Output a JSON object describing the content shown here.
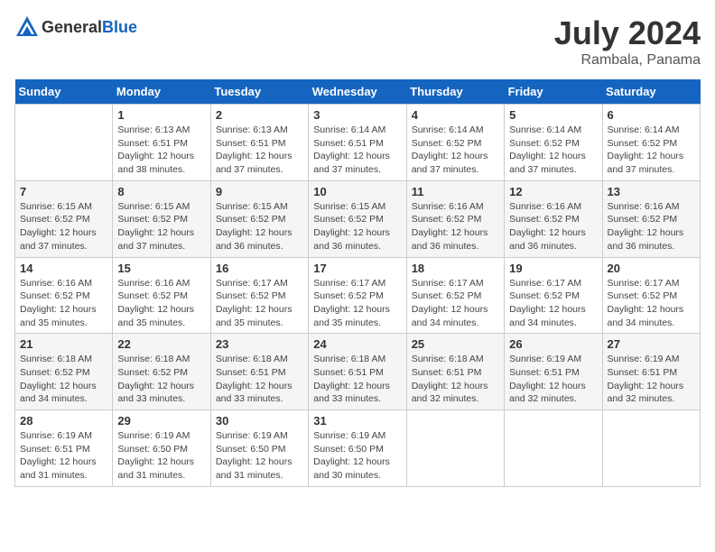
{
  "header": {
    "logo_general": "General",
    "logo_blue": "Blue",
    "month_title": "July 2024",
    "location": "Rambala, Panama"
  },
  "days_of_week": [
    "Sunday",
    "Monday",
    "Tuesday",
    "Wednesday",
    "Thursday",
    "Friday",
    "Saturday"
  ],
  "weeks": [
    [
      {
        "day": "",
        "info": ""
      },
      {
        "day": "1",
        "info": "Sunrise: 6:13 AM\nSunset: 6:51 PM\nDaylight: 12 hours\nand 38 minutes."
      },
      {
        "day": "2",
        "info": "Sunrise: 6:13 AM\nSunset: 6:51 PM\nDaylight: 12 hours\nand 37 minutes."
      },
      {
        "day": "3",
        "info": "Sunrise: 6:14 AM\nSunset: 6:51 PM\nDaylight: 12 hours\nand 37 minutes."
      },
      {
        "day": "4",
        "info": "Sunrise: 6:14 AM\nSunset: 6:52 PM\nDaylight: 12 hours\nand 37 minutes."
      },
      {
        "day": "5",
        "info": "Sunrise: 6:14 AM\nSunset: 6:52 PM\nDaylight: 12 hours\nand 37 minutes."
      },
      {
        "day": "6",
        "info": "Sunrise: 6:14 AM\nSunset: 6:52 PM\nDaylight: 12 hours\nand 37 minutes."
      }
    ],
    [
      {
        "day": "7",
        "info": "Sunrise: 6:15 AM\nSunset: 6:52 PM\nDaylight: 12 hours\nand 37 minutes."
      },
      {
        "day": "8",
        "info": "Sunrise: 6:15 AM\nSunset: 6:52 PM\nDaylight: 12 hours\nand 37 minutes."
      },
      {
        "day": "9",
        "info": "Sunrise: 6:15 AM\nSunset: 6:52 PM\nDaylight: 12 hours\nand 36 minutes."
      },
      {
        "day": "10",
        "info": "Sunrise: 6:15 AM\nSunset: 6:52 PM\nDaylight: 12 hours\nand 36 minutes."
      },
      {
        "day": "11",
        "info": "Sunrise: 6:16 AM\nSunset: 6:52 PM\nDaylight: 12 hours\nand 36 minutes."
      },
      {
        "day": "12",
        "info": "Sunrise: 6:16 AM\nSunset: 6:52 PM\nDaylight: 12 hours\nand 36 minutes."
      },
      {
        "day": "13",
        "info": "Sunrise: 6:16 AM\nSunset: 6:52 PM\nDaylight: 12 hours\nand 36 minutes."
      }
    ],
    [
      {
        "day": "14",
        "info": "Sunrise: 6:16 AM\nSunset: 6:52 PM\nDaylight: 12 hours\nand 35 minutes."
      },
      {
        "day": "15",
        "info": "Sunrise: 6:16 AM\nSunset: 6:52 PM\nDaylight: 12 hours\nand 35 minutes."
      },
      {
        "day": "16",
        "info": "Sunrise: 6:17 AM\nSunset: 6:52 PM\nDaylight: 12 hours\nand 35 minutes."
      },
      {
        "day": "17",
        "info": "Sunrise: 6:17 AM\nSunset: 6:52 PM\nDaylight: 12 hours\nand 35 minutes."
      },
      {
        "day": "18",
        "info": "Sunrise: 6:17 AM\nSunset: 6:52 PM\nDaylight: 12 hours\nand 34 minutes."
      },
      {
        "day": "19",
        "info": "Sunrise: 6:17 AM\nSunset: 6:52 PM\nDaylight: 12 hours\nand 34 minutes."
      },
      {
        "day": "20",
        "info": "Sunrise: 6:17 AM\nSunset: 6:52 PM\nDaylight: 12 hours\nand 34 minutes."
      }
    ],
    [
      {
        "day": "21",
        "info": "Sunrise: 6:18 AM\nSunset: 6:52 PM\nDaylight: 12 hours\nand 34 minutes."
      },
      {
        "day": "22",
        "info": "Sunrise: 6:18 AM\nSunset: 6:52 PM\nDaylight: 12 hours\nand 33 minutes."
      },
      {
        "day": "23",
        "info": "Sunrise: 6:18 AM\nSunset: 6:51 PM\nDaylight: 12 hours\nand 33 minutes."
      },
      {
        "day": "24",
        "info": "Sunrise: 6:18 AM\nSunset: 6:51 PM\nDaylight: 12 hours\nand 33 minutes."
      },
      {
        "day": "25",
        "info": "Sunrise: 6:18 AM\nSunset: 6:51 PM\nDaylight: 12 hours\nand 32 minutes."
      },
      {
        "day": "26",
        "info": "Sunrise: 6:19 AM\nSunset: 6:51 PM\nDaylight: 12 hours\nand 32 minutes."
      },
      {
        "day": "27",
        "info": "Sunrise: 6:19 AM\nSunset: 6:51 PM\nDaylight: 12 hours\nand 32 minutes."
      }
    ],
    [
      {
        "day": "28",
        "info": "Sunrise: 6:19 AM\nSunset: 6:51 PM\nDaylight: 12 hours\nand 31 minutes."
      },
      {
        "day": "29",
        "info": "Sunrise: 6:19 AM\nSunset: 6:50 PM\nDaylight: 12 hours\nand 31 minutes."
      },
      {
        "day": "30",
        "info": "Sunrise: 6:19 AM\nSunset: 6:50 PM\nDaylight: 12 hours\nand 31 minutes."
      },
      {
        "day": "31",
        "info": "Sunrise: 6:19 AM\nSunset: 6:50 PM\nDaylight: 12 hours\nand 30 minutes."
      },
      {
        "day": "",
        "info": ""
      },
      {
        "day": "",
        "info": ""
      },
      {
        "day": "",
        "info": ""
      }
    ]
  ]
}
